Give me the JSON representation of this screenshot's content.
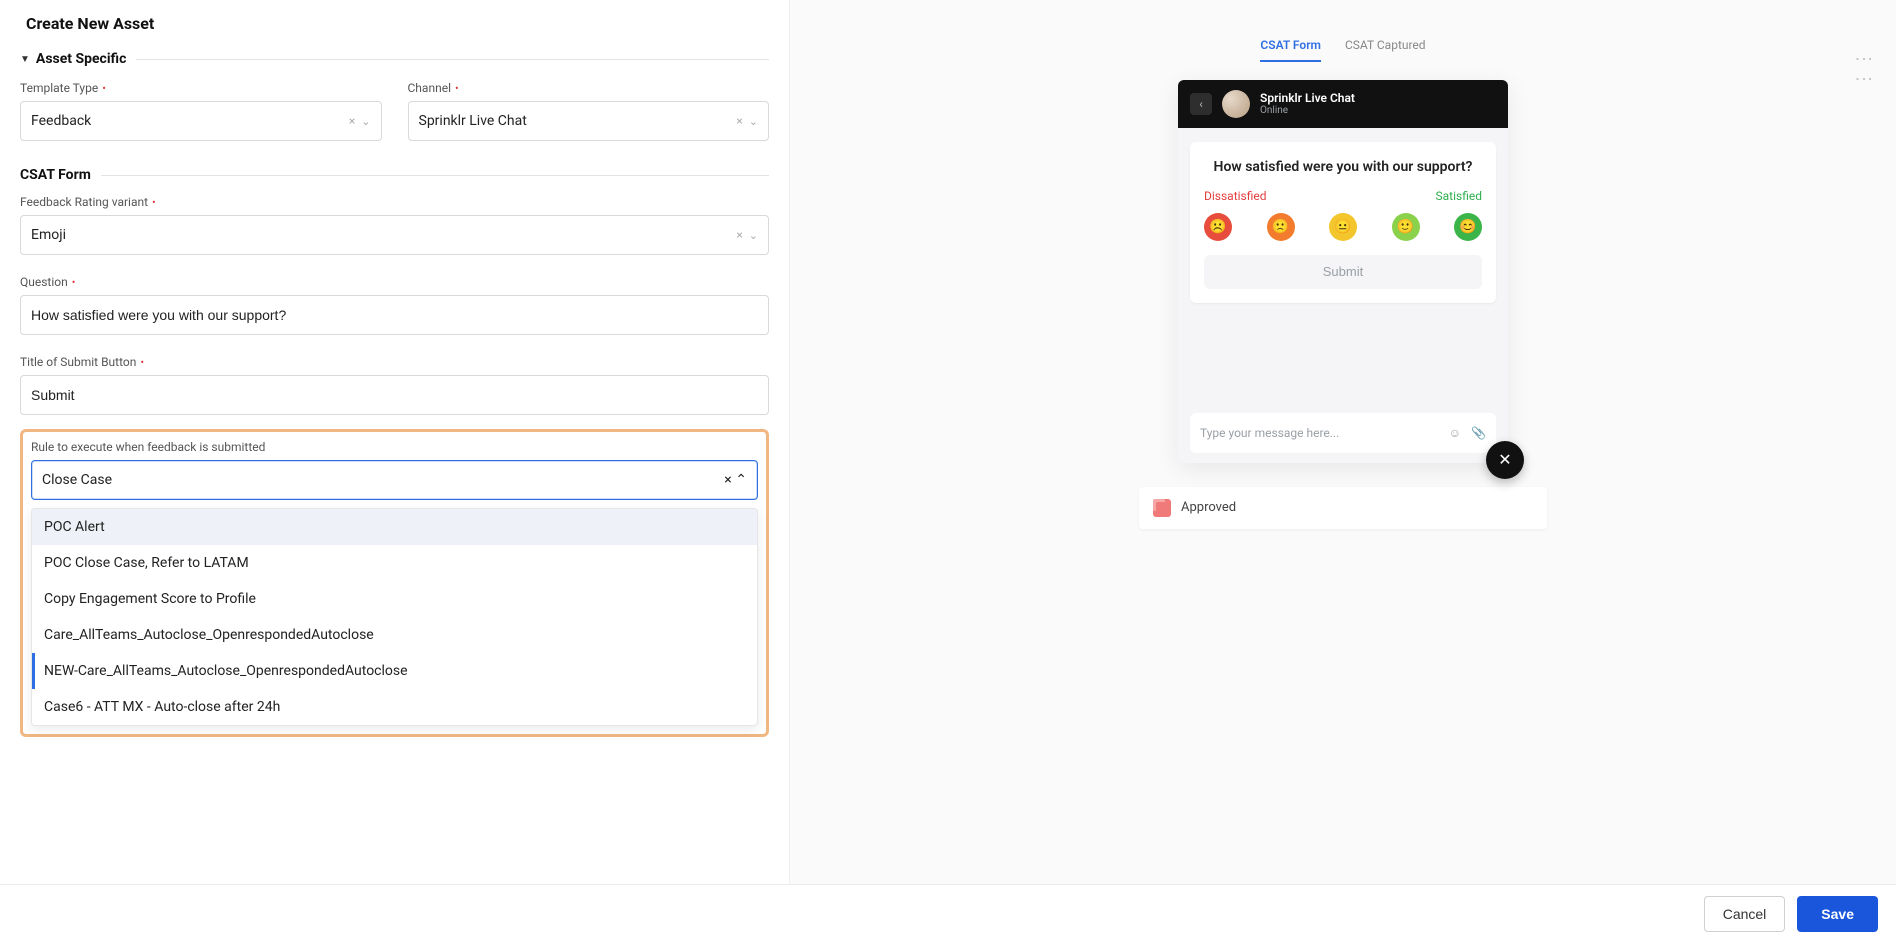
{
  "page_title": "Create New Asset",
  "section": {
    "asset_specific": "Asset Specific",
    "csat_form": "CSAT Form"
  },
  "fields": {
    "template_type": {
      "label": "Template Type",
      "value": "Feedback",
      "required": true
    },
    "channel": {
      "label": "Channel",
      "value": "Sprinklr Live Chat",
      "required": true
    },
    "rating_variant": {
      "label": "Feedback Rating variant",
      "value": "Emoji",
      "required": true
    },
    "question": {
      "label": "Question",
      "value": "How satisfied were you with our support?",
      "required": true
    },
    "submit_title": {
      "label": "Title of Submit Button",
      "value": "Submit",
      "required": true
    },
    "rule": {
      "label": "Rule to execute when feedback is submitted",
      "value": "Close Case",
      "required": false
    }
  },
  "rule_options": [
    "POC Alert",
    "POC Close Case, Refer to LATAM",
    "Copy Engagement Score to Profile",
    "Care_AllTeams_Autoclose_OpenrespondedAutoclose",
    "NEW-Care_AllTeams_Autoclose_OpenrespondedAutoclose",
    "Case6 - ATT MX - Auto-close after 24h"
  ],
  "rule_highlight_index": 0,
  "rule_selected_index": 4,
  "preview": {
    "tabs": {
      "form": "CSAT Form",
      "captured": "CSAT Captured"
    },
    "chat": {
      "title": "Sprinklr Live Chat",
      "status": "Online"
    },
    "question": "How satisfied were you with our support?",
    "labels": {
      "dissatisfied": "Dissatisfied",
      "satisfied": "Satisfied"
    },
    "submit": "Submit",
    "input_placeholder": "Type your message here...",
    "approved": "Approved"
  },
  "footer": {
    "cancel": "Cancel",
    "save": "Save"
  }
}
